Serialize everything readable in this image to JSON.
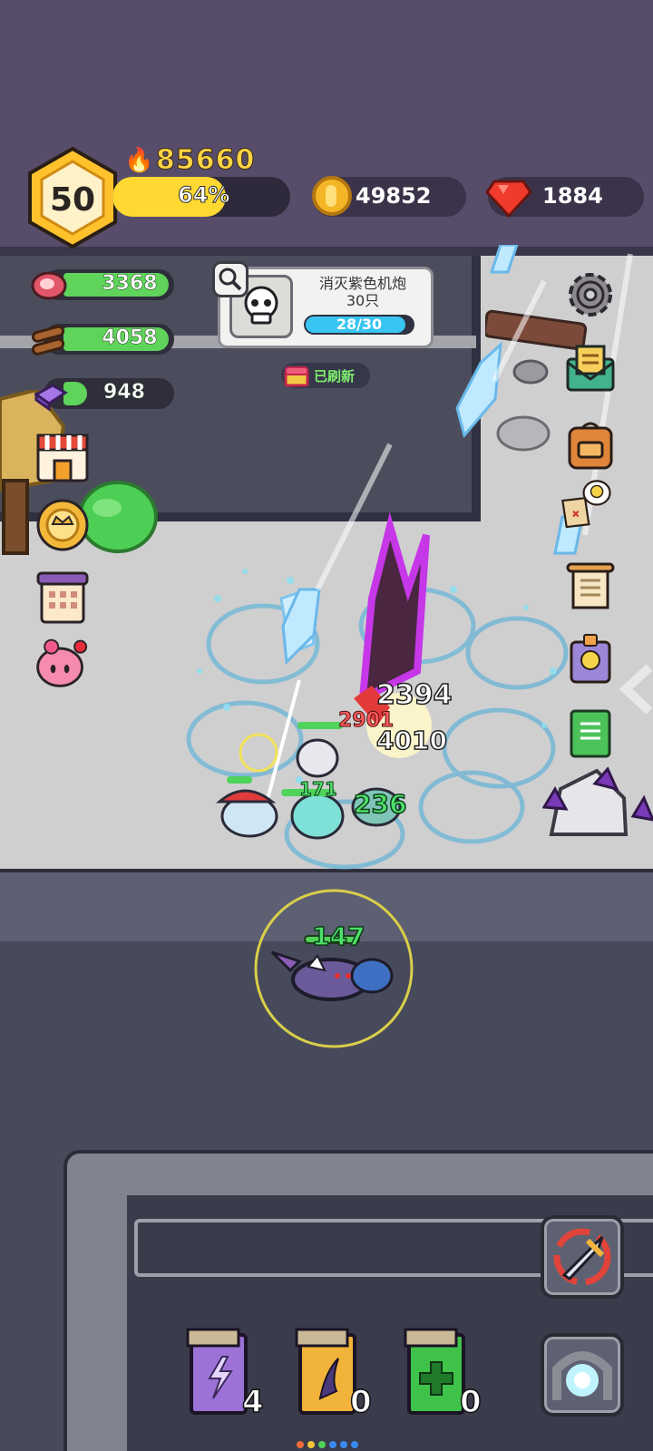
{
  "player": {
    "level": "50",
    "power": "85660",
    "xp_percent_label": "64%",
    "xp_fraction": 0.64
  },
  "currencies": {
    "coins": "49852",
    "gems": "1884"
  },
  "resources": [
    {
      "name": "meat",
      "value": "3368",
      "fill": 0.95
    },
    {
      "name": "wood",
      "value": "4058",
      "fill": 0.95
    },
    {
      "name": "ore",
      "value": "948",
      "fill": 0.2
    }
  ],
  "quest": {
    "title": "消灭紫色机炮\n30只",
    "progress": "28/30",
    "fraction": 0.933,
    "refresh_label": "已刷新"
  },
  "left_menu": [
    "shop-icon",
    "crown-medal-icon",
    "calendar-icon",
    "pink-pet-icon"
  ],
  "right_menu": [
    "gear-icon",
    "mail-icon",
    "backpack-icon",
    "treasure-map-icon",
    "scroll-icon",
    "skull-card-icon",
    "green-book-icon"
  ],
  "damage_numbers": [
    {
      "text": "2394",
      "color": "#ffffff"
    },
    {
      "text": "2901",
      "color": "#ff5a5a"
    },
    {
      "text": "4010",
      "color": "#ffffff"
    },
    {
      "text": "171",
      "color": "#4ee06b"
    },
    {
      "text": "236",
      "color": "#4ee06b"
    },
    {
      "text": "147",
      "color": "#4ee06b"
    }
  ],
  "skill_books": [
    {
      "name": "lightning-book",
      "count": "4"
    },
    {
      "name": "wind-book",
      "count": "0"
    },
    {
      "name": "heal-book",
      "count": "0"
    }
  ],
  "colors": {
    "gold": "#ffd445",
    "green": "#5fd35a",
    "cyan": "#39c5f2",
    "purple_bg": "#574d6a"
  }
}
